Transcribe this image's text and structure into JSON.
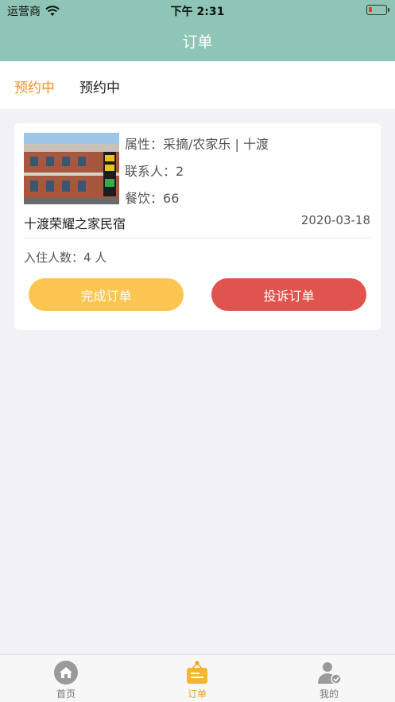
{
  "status_bar": {
    "carrier": "运营商",
    "time": "下午 2:31"
  },
  "nav": {
    "title": "订单"
  },
  "tabs": [
    {
      "label": "预约中",
      "active": true
    },
    {
      "label": "预约中",
      "active": false
    }
  ],
  "order": {
    "attr_label": "属性：",
    "attr_value": "采摘/农家乐 | 十渡",
    "contact_label": "联系人：",
    "contact_value": "2",
    "dining_label": "餐饮：",
    "dining_value": "66",
    "name": "十渡荣耀之家民宿",
    "date": "2020-03-18",
    "guests": "入住人数：4 人",
    "complete_button": "完成订单",
    "complain_button": "投诉订单"
  },
  "tabbar": [
    {
      "label": "首页",
      "icon": "home-icon"
    },
    {
      "label": "订单",
      "icon": "order-icon",
      "active": true
    },
    {
      "label": "我的",
      "icon": "user-icon"
    }
  ],
  "colors": {
    "header": "#8ec5b6",
    "accent": "#f0941f",
    "complete": "#fcc550",
    "complain": "#e1534e"
  }
}
